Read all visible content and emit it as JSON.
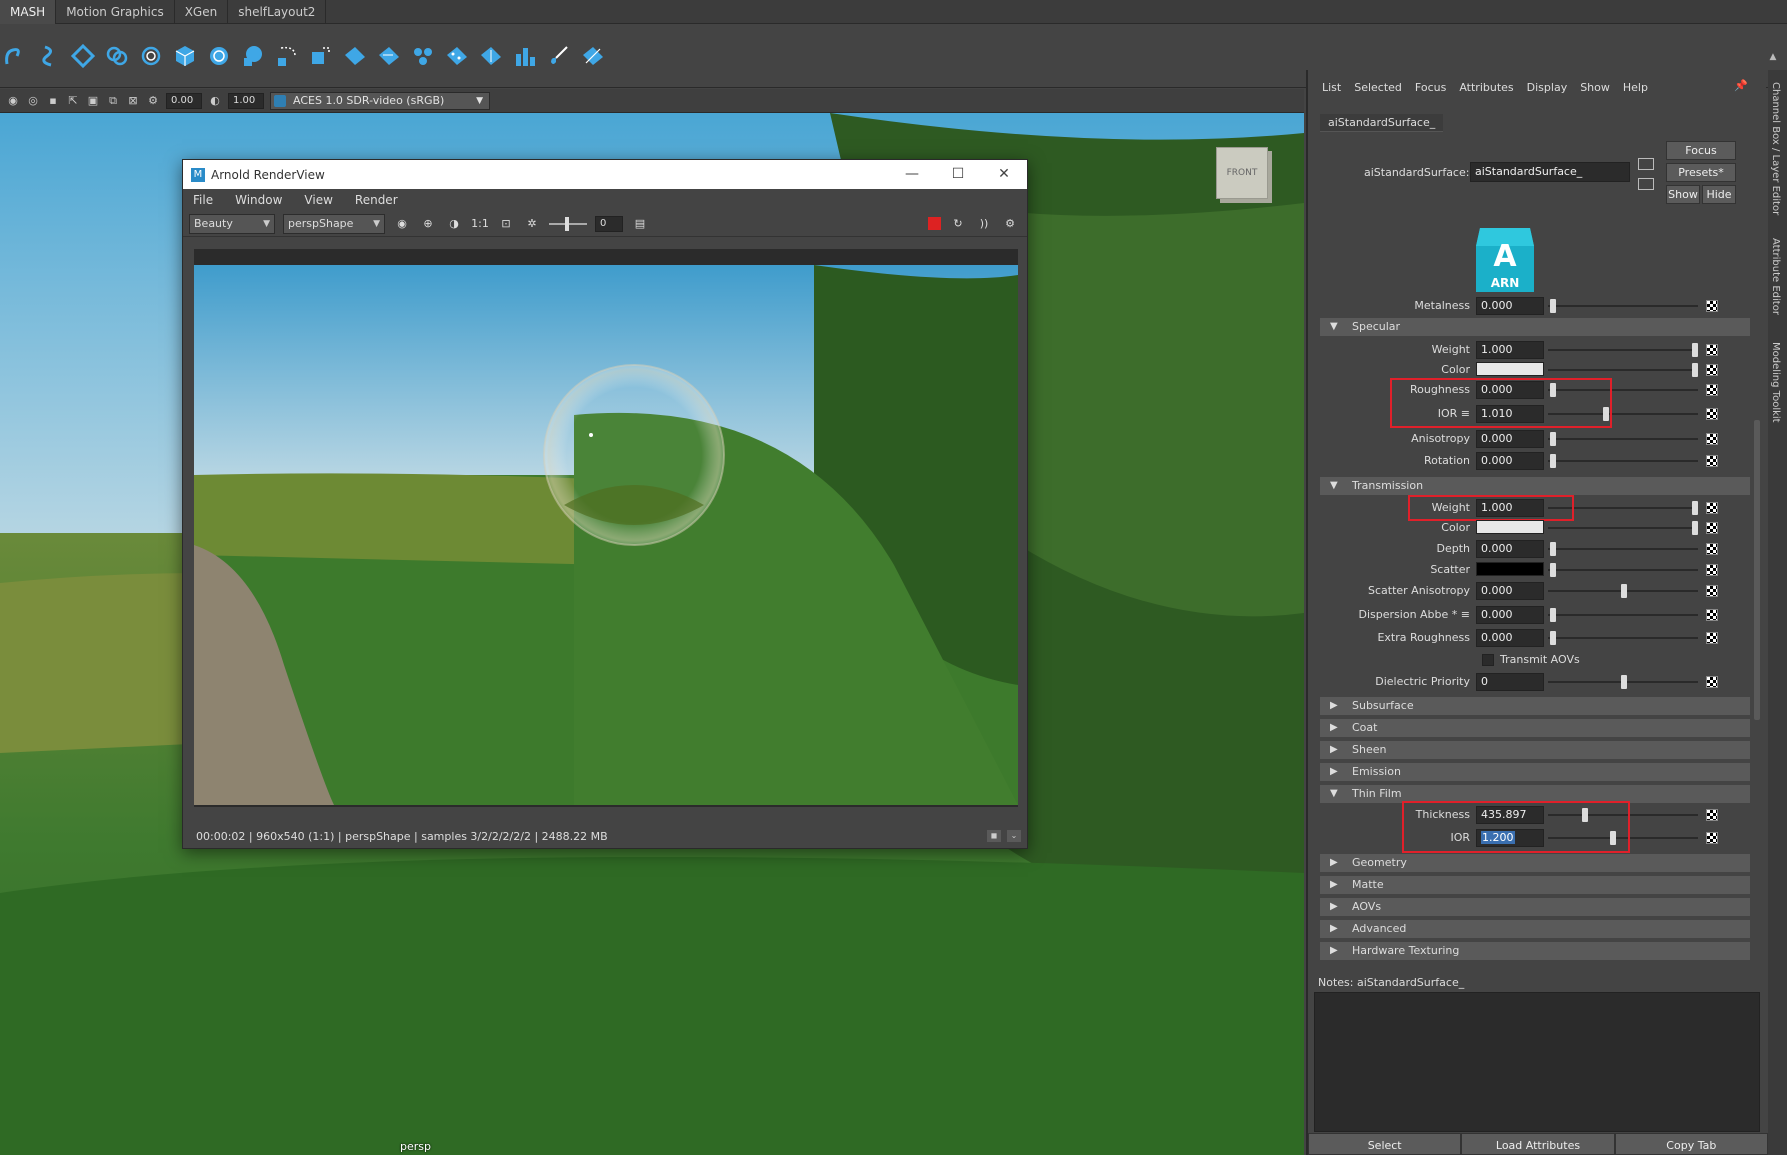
{
  "shelf": {
    "tabs": [
      "MASH",
      "Motion Graphics",
      "XGen",
      "shelfLayout2"
    ],
    "active_tab": 0,
    "tools": [
      "spiral-tool-icon",
      "curve-tool-icon",
      "diamond-tool-icon",
      "coil-tool-icon",
      "helix-tool-icon",
      "cube-tool-icon",
      "sphere-tool-icon",
      "blob-tool-icon",
      "selection-tool-icon",
      "transform-tool-icon",
      "plane-tool-icon",
      "plane2-tool-icon",
      "network-tool-icon",
      "scatter-tool-icon",
      "distribute-tool-icon",
      "bars-tool-icon",
      "brush-tool-icon",
      "sweep-tool-icon"
    ]
  },
  "viewport": {
    "toolbar": {
      "field1": "0.00",
      "field2": "1.00",
      "colorspace": "ACES 1.0 SDR-video (sRGB)"
    },
    "camera_label": "persp",
    "viewcube_label": "FRONT"
  },
  "renderview": {
    "title": "Arnold RenderView",
    "menu": [
      "File",
      "Window",
      "View",
      "Render"
    ],
    "aov": "Beauty",
    "camera": "perspShape",
    "ratio": "1:1",
    "exposure": "0",
    "status": "00:00:02 | 960x540 (1:1) | perspShape  | samples 3/2/2/2/2/2 | 2488.22 MB"
  },
  "ae": {
    "menu": [
      "List",
      "Selected",
      "Focus",
      "Attributes",
      "Display",
      "Show",
      "Help"
    ],
    "tab": "aiStandardSurface_",
    "node_label": "aiStandardSurface:",
    "node_value": "aiStandardSurface_",
    "buttons": {
      "focus": "Focus",
      "presets": "Presets*",
      "show": "Show",
      "hide": "Hide"
    },
    "logo_letter": "A",
    "logo_text": "ARN",
    "rows": {
      "metalness": {
        "label": "Metalness",
        "value": "0.000"
      },
      "specular_title": "Specular",
      "spec_weight": {
        "label": "Weight",
        "value": "1.000"
      },
      "spec_color": {
        "label": "Color"
      },
      "spec_roughness": {
        "label": "Roughness",
        "value": "0.000"
      },
      "spec_ior": {
        "label": "IOR ≡",
        "value": "1.010"
      },
      "spec_aniso": {
        "label": "Anisotropy",
        "value": "0.000"
      },
      "spec_rotation": {
        "label": "Rotation",
        "value": "0.000"
      },
      "transmission_title": "Transmission",
      "tr_weight": {
        "label": "Weight",
        "value": "1.000"
      },
      "tr_color": {
        "label": "Color"
      },
      "tr_depth": {
        "label": "Depth",
        "value": "0.000"
      },
      "tr_scatter": {
        "label": "Scatter"
      },
      "tr_scatter_aniso": {
        "label": "Scatter Anisotropy",
        "value": "0.000"
      },
      "tr_dispersion": {
        "label": "Dispersion Abbe * ≡",
        "value": "0.000"
      },
      "tr_extra_rough": {
        "label": "Extra Roughness",
        "value": "0.000"
      },
      "tr_aovs": {
        "label": "Transmit AOVs"
      },
      "tr_dielectric": {
        "label": "Dielectric Priority",
        "value": "0"
      },
      "subsurface_title": "Subsurface",
      "coat_title": "Coat",
      "sheen_title": "Sheen",
      "emission_title": "Emission",
      "thinfilm_title": "Thin Film",
      "tf_thickness": {
        "label": "Thickness",
        "value": "435.897"
      },
      "tf_ior": {
        "label": "IOR",
        "value": "1.200"
      },
      "geometry_title": "Geometry",
      "matte_title": "Matte",
      "aovs_title": "AOVs",
      "advanced_title": "Advanced",
      "hwtex_title": "Hardware Texturing"
    },
    "notes_label": "Notes:  aiStandardSurface_",
    "bottom_buttons": [
      "Select",
      "Load Attributes",
      "Copy Tab"
    ],
    "accent_highlight": "#e0202a"
  },
  "vtabs": [
    "Channel Box / Layer Editor",
    "Attribute Editor",
    "Modeling Toolkit"
  ]
}
